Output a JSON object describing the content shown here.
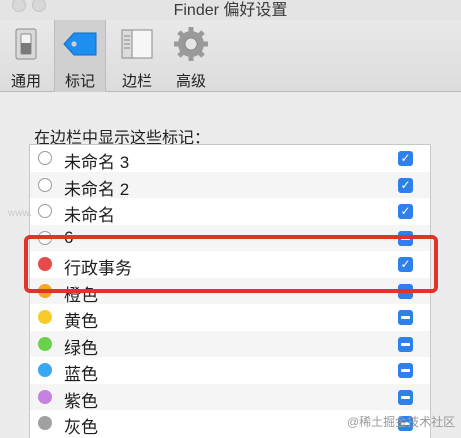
{
  "window": {
    "title": "Finder 偏好设置"
  },
  "toolbar": {
    "items": [
      {
        "label": "通用",
        "icon": "switch-icon"
      },
      {
        "label": "标记",
        "icon": "tag-icon",
        "selected": true
      },
      {
        "label": "边栏",
        "icon": "sidebar-icon"
      },
      {
        "label": "高级",
        "icon": "gear-icon"
      }
    ]
  },
  "main": {
    "heading": "在边栏中显示这些标记：",
    "tags": [
      {
        "label": "未命名 3",
        "color": "none",
        "checked": true
      },
      {
        "label": "未命名 2",
        "color": "none",
        "checked": true
      },
      {
        "label": "未命名",
        "color": "none",
        "checked": true
      },
      {
        "label": "6",
        "color": "none",
        "checked": "mixed"
      },
      {
        "label": "行政事务",
        "color": "#e8494b",
        "checked": true
      },
      {
        "label": "橙色",
        "color": "#f5a623",
        "checked": "mixed"
      },
      {
        "label": "黄色",
        "color": "#f5cc29",
        "checked": "mixed"
      },
      {
        "label": "绿色",
        "color": "#6cd14a",
        "checked": "mixed"
      },
      {
        "label": "蓝色",
        "color": "#3aa7f2",
        "checked": "mixed"
      },
      {
        "label": "紫色",
        "color": "#c582df",
        "checked": "mixed"
      },
      {
        "label": "灰色",
        "color": "#a1a1a1",
        "checked": "mixed"
      }
    ]
  },
  "colors": {
    "accent": "#2f80ea",
    "annotation": "#e0332a"
  },
  "watermark": {
    "text": "@稀土掘金技术社区"
  }
}
